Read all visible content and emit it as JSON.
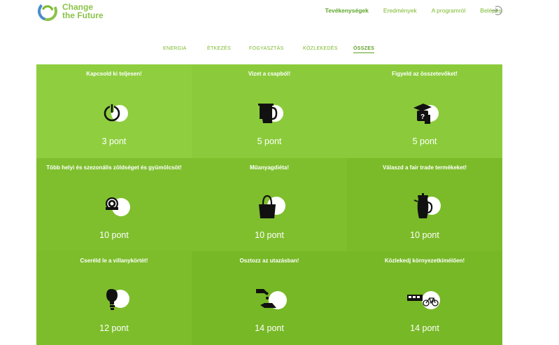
{
  "brand": {
    "line1": "Change",
    "line2": "the Future"
  },
  "topnav": {
    "items": [
      {
        "label": "Tevékenységek",
        "active": true
      },
      {
        "label": "Eredmények",
        "active": false
      },
      {
        "label": "A programról",
        "active": false
      },
      {
        "label": "Belépés",
        "active": false
      }
    ],
    "login_icon": "login-icon"
  },
  "categories": [
    {
      "label": "ENERGIA",
      "active": false
    },
    {
      "label": "ÉTKEZÉS",
      "active": false
    },
    {
      "label": "FOGYASZTÁS",
      "active": false
    },
    {
      "label": "KÖZLEKEDÉS",
      "active": false
    },
    {
      "label": "ÖSSZES",
      "active": true
    }
  ],
  "tiles": [
    {
      "title": "Kapcsold ki teljesen!",
      "points": "3 pont",
      "icon": "power-icon",
      "color": "#8fce3f"
    },
    {
      "title": "Vizet a csapból!",
      "points": "5 pont",
      "icon": "jug-icon",
      "color": "#8bcb3b"
    },
    {
      "title": "Figyeld az összetevőket!",
      "points": "5 pont",
      "icon": "ingredients-icon",
      "color": "#8bcb3b"
    },
    {
      "title": "Több helyi és szezonális zöldséget és gyümölcsöt!",
      "points": "10 pont",
      "icon": "coin-icon",
      "color": "#7fbf2e"
    },
    {
      "title": "Műanyagdiéta!",
      "points": "10 pont",
      "icon": "bag-icon",
      "color": "#7fbf2e"
    },
    {
      "title": "Válaszd a fair trade termékeket!",
      "points": "10 pont",
      "icon": "coffee-pot-icon",
      "color": "#7bbb29"
    },
    {
      "title": "Cseréld le a villanykörtét!",
      "points": "12 pont",
      "icon": "lightbulb-icon",
      "color": "#7dbd2b"
    },
    {
      "title": "Osztozz az utazásban!",
      "points": "14 pont",
      "icon": "share-ride-icon",
      "color": "#77b826"
    },
    {
      "title": "Közlekedj környezetkímélően!",
      "points": "14 pont",
      "icon": "bike-bus-icon",
      "color": "#77b826"
    }
  ]
}
